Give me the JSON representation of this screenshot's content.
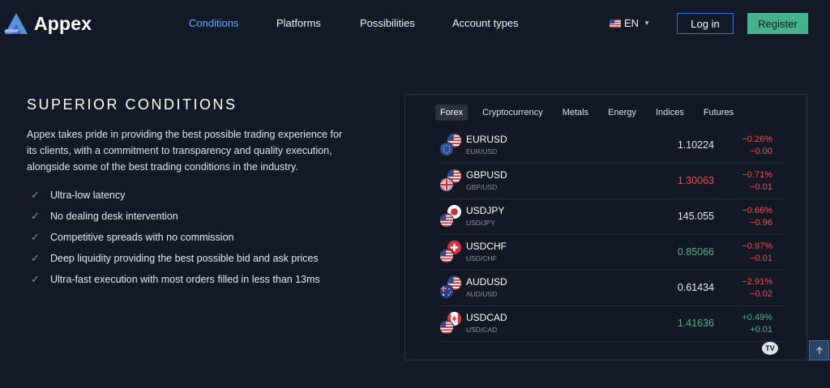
{
  "header": {
    "logo_text": "Appex",
    "nav": [
      "Conditions",
      "Platforms",
      "Possibilities",
      "Account types"
    ],
    "active_nav": "Conditions",
    "language": "EN",
    "login_label": "Log in",
    "register_label": "Register"
  },
  "content": {
    "heading": "SUPERIOR CONDITIONS",
    "intro": "Appex takes pride in providing the best possible trading experience for its clients, with a commitment to transparency and quality execution, alongside some of the best trading conditions in the industry.",
    "features": [
      "Ultra-low latency",
      "No dealing desk intervention",
      "Competitive spreads with no commission",
      "Deep liquidity providing the best possible bid and ask prices",
      "Ultra-fast execution with most orders filled in less than 13ms"
    ]
  },
  "widget": {
    "tabs": [
      "Forex",
      "Cryptocurrency",
      "Metals",
      "Energy",
      "Indices",
      "Futures"
    ],
    "active_tab": "Forex",
    "rows": [
      {
        "symbol": "EURUSD",
        "sub": "EUR/USD",
        "price": "1.10224",
        "price_dir": "flat",
        "change_pct": "−0.26%",
        "change_abs": "−0.00",
        "dir": "down",
        "flag_a": "eu-flag",
        "flag_b": "us-flag"
      },
      {
        "symbol": "GBPUSD",
        "sub": "GBP/USD",
        "price": "1.30063",
        "price_dir": "down",
        "change_pct": "−0.71%",
        "change_abs": "−0.01",
        "dir": "down",
        "flag_a": "uk-flag",
        "flag_b": "us-flag"
      },
      {
        "symbol": "USDJPY",
        "sub": "USD/JPY",
        "price": "145.055",
        "price_dir": "flat",
        "change_pct": "−0.66%",
        "change_abs": "−0.96",
        "dir": "down",
        "flag_a": "us-flag",
        "flag_b": "jp-flag"
      },
      {
        "symbol": "USDCHF",
        "sub": "USD/CHF",
        "price": "0.85066",
        "price_dir": "up",
        "change_pct": "−0.97%",
        "change_abs": "−0.01",
        "dir": "down",
        "flag_a": "us-flag",
        "flag_b": "ch-flag"
      },
      {
        "symbol": "AUDUSD",
        "sub": "AUD/USD",
        "price": "0.61434",
        "price_dir": "flat",
        "change_pct": "−2.91%",
        "change_abs": "−0.02",
        "dir": "down",
        "flag_a": "au-flag",
        "flag_b": "us-flag"
      },
      {
        "symbol": "USDCAD",
        "sub": "USD/CAD",
        "price": "1.41636",
        "price_dir": "up",
        "change_pct": "+0.49%",
        "change_abs": "+0.01",
        "dir": "up",
        "flag_a": "us-flag",
        "flag_b": "ca-flag"
      }
    ],
    "badge": "TV"
  },
  "colors": {
    "background": "#131a27",
    "accent_blue": "#6ea8f5",
    "register_green": "#47b08c",
    "positive": "#4fb18d",
    "negative": "#e45458"
  }
}
